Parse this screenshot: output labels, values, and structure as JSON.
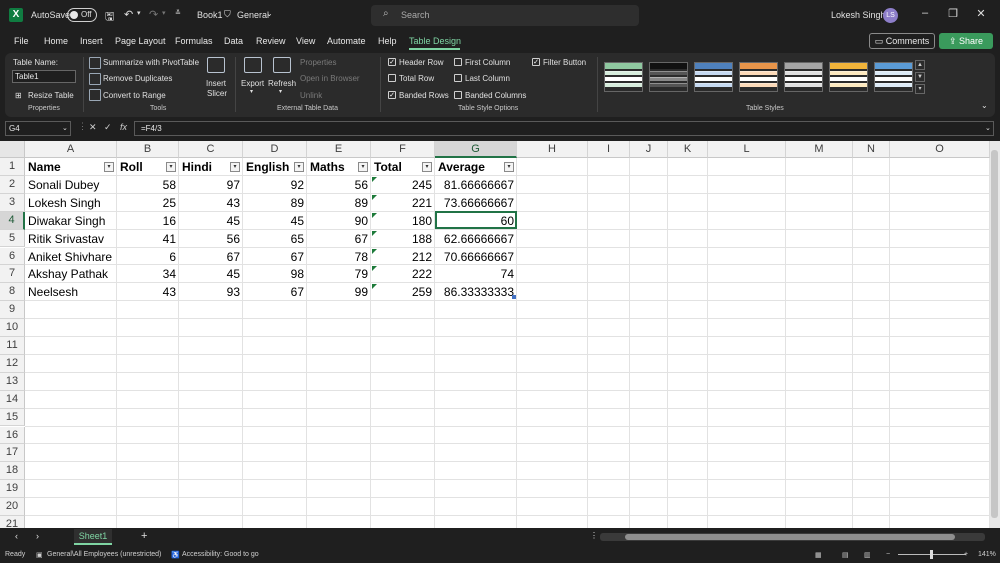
{
  "titlebar": {
    "autosave_label": "AutoSave",
    "autosave_state": "Off",
    "doc_name": "Book1",
    "sensitivity": "General",
    "search_placeholder": "Search",
    "user_name": "Lokesh Singh",
    "user_initials": "LS"
  },
  "menu": {
    "tabs": [
      "File",
      "Home",
      "Insert",
      "Page Layout",
      "Formulas",
      "Data",
      "Review",
      "View",
      "Automate",
      "Help",
      "Table Design"
    ],
    "active_tab": "Table Design",
    "comments_label": "Comments",
    "share_label": "Share"
  },
  "ribbon": {
    "properties": {
      "table_name_label": "Table Name:",
      "table_name_value": "Table1",
      "resize_label": "Resize Table",
      "group_label": "Properties"
    },
    "tools": {
      "pivot": "Summarize with PivotTable",
      "dupes": "Remove Duplicates",
      "convert": "Convert to Range",
      "slicer_1": "Insert",
      "slicer_2": "Slicer",
      "group_label": "Tools"
    },
    "external": {
      "export": "Export",
      "refresh": "Refresh",
      "properties": "Properties",
      "open_browser": "Open in Browser",
      "unlink": "Unlink",
      "group_label": "External Table Data"
    },
    "style_options": {
      "header_row": "Header Row",
      "total_row": "Total Row",
      "banded_rows": "Banded Rows",
      "first_column": "First Column",
      "last_column": "Last Column",
      "banded_columns": "Banded Columns",
      "filter_button": "Filter Button",
      "group_label": "Table Style Options"
    },
    "styles": {
      "group_label": "Table Styles"
    }
  },
  "formula_bar": {
    "name_box": "G4",
    "formula": "=F4/3",
    "fx": "fx"
  },
  "columns": [
    "A",
    "B",
    "C",
    "D",
    "E",
    "F",
    "G",
    "H",
    "I",
    "J",
    "K",
    "L",
    "M",
    "N",
    "O"
  ],
  "rows": [
    "1",
    "2",
    "3",
    "4",
    "5",
    "6",
    "7",
    "8",
    "9",
    "10",
    "11",
    "12",
    "13",
    "14",
    "15",
    "16",
    "17",
    "18",
    "19",
    "20",
    "21"
  ],
  "table": {
    "headers": [
      "Name",
      "Roll",
      "Hindi",
      "English",
      "Maths",
      "Total",
      "Average"
    ],
    "data": [
      [
        "Sonali Dubey",
        "58",
        "97",
        "92",
        "56",
        "245",
        "81.66666667"
      ],
      [
        "Lokesh Singh",
        "25",
        "43",
        "89",
        "89",
        "221",
        "73.66666667"
      ],
      [
        "Diwakar Singh",
        "16",
        "45",
        "45",
        "90",
        "180",
        "60"
      ],
      [
        "Ritik Srivastav",
        "41",
        "56",
        "65",
        "67",
        "188",
        "62.66666667"
      ],
      [
        "Aniket Shivhare",
        "6",
        "67",
        "67",
        "78",
        "212",
        "70.66666667"
      ],
      [
        "Akshay Pathak",
        "34",
        "45",
        "98",
        "79",
        "222",
        "74"
      ],
      [
        "Neelsesh",
        "43",
        "93",
        "67",
        "99",
        "259",
        "86.33333333"
      ]
    ]
  },
  "sheets": {
    "active": "Sheet1",
    "add": "+"
  },
  "status": {
    "ready": "Ready",
    "label": "General\\All Employees (unrestricted)",
    "accessibility": "Accessibility: Good to go",
    "zoom": "141%"
  },
  "colors": {
    "accent": "#217346",
    "tab_active": "#7fd4a3"
  }
}
